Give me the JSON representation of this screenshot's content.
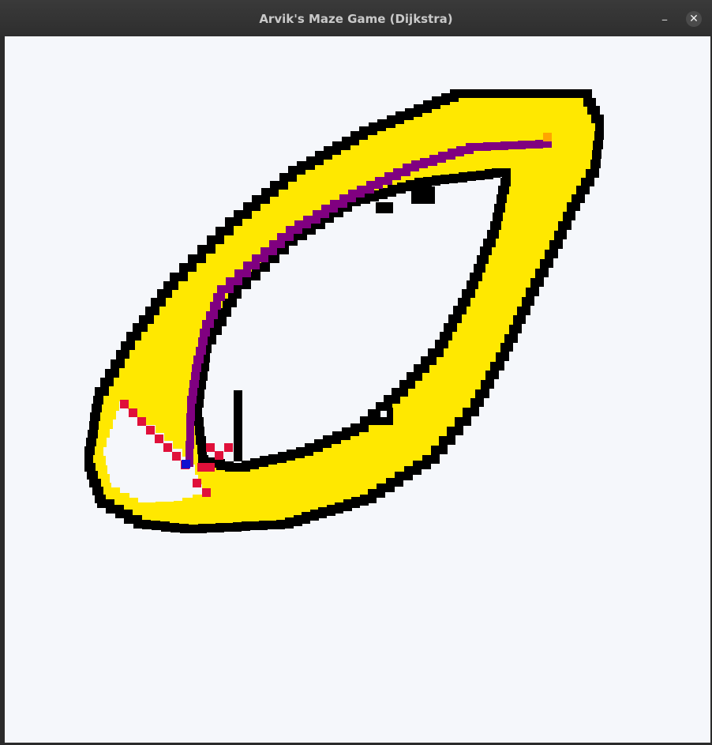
{
  "window": {
    "title": "Arvik's Maze Game (Dijkstra)",
    "minimize_glyph": "–",
    "close_glyph": "✕"
  },
  "maze": {
    "algorithm": "Dijkstra",
    "colors": {
      "background": "#f5f7fb",
      "wall": "#000000",
      "visited": "#ffe800",
      "path": "#800080",
      "frontier": "#e0103a",
      "start": "#1010d0",
      "goal": "#ffa500"
    }
  }
}
